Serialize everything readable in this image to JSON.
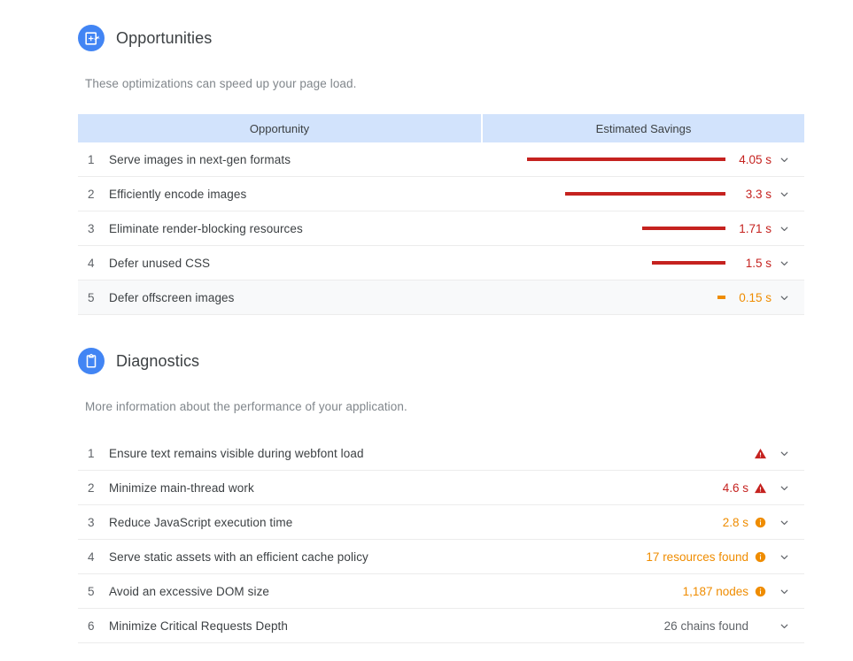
{
  "opportunities": {
    "icon": "opportunity-image-icon",
    "title": "Opportunities",
    "subtitle": "These optimizations can speed up your page load.",
    "columns": {
      "name": "Opportunity",
      "savings": "Estimated Savings"
    },
    "rows": [
      {
        "index": "1",
        "title": "Serve images in next-gen formats",
        "value": "4.05 s",
        "bar_pct": 100,
        "severity": "fail"
      },
      {
        "index": "2",
        "title": "Efficiently encode images",
        "value": "3.3 s",
        "bar_pct": 81,
        "severity": "fail"
      },
      {
        "index": "3",
        "title": "Eliminate render-blocking resources",
        "value": "1.71 s",
        "bar_pct": 42,
        "severity": "fail"
      },
      {
        "index": "4",
        "title": "Defer unused CSS",
        "value": "1.5 s",
        "bar_pct": 37,
        "severity": "fail"
      },
      {
        "index": "5",
        "title": "Defer offscreen images",
        "value": "0.15 s",
        "bar_pct": 4,
        "severity": "average"
      }
    ]
  },
  "diagnostics": {
    "icon": "clipboard-icon",
    "title": "Diagnostics",
    "subtitle": "More information about the performance of your application.",
    "rows": [
      {
        "index": "1",
        "title": "Ensure text remains visible during webfont load",
        "value": "",
        "status": "fail",
        "status_icon": "warning-triangle-icon"
      },
      {
        "index": "2",
        "title": "Minimize main-thread work",
        "value": "4.6 s",
        "status": "fail",
        "status_icon": "warning-triangle-icon"
      },
      {
        "index": "3",
        "title": "Reduce JavaScript execution time",
        "value": "2.8 s",
        "status": "average",
        "status_icon": "info-circle-icon"
      },
      {
        "index": "4",
        "title": "Serve static assets with an efficient cache policy",
        "value": "17 resources found",
        "status": "average",
        "status_icon": "info-circle-icon"
      },
      {
        "index": "5",
        "title": "Avoid an excessive DOM size",
        "value": "1,187 nodes",
        "status": "average",
        "status_icon": "info-circle-icon"
      },
      {
        "index": "6",
        "title": "Minimize Critical Requests Depth",
        "value": "26 chains found",
        "status": "none",
        "status_icon": ""
      }
    ]
  },
  "colors": {
    "accent_blue": "#4285f4",
    "header_blue": "#d2e3fc",
    "fail_red": "#c5221f",
    "average_orange": "#ef8c00",
    "neutral_gray": "#5f6368",
    "alt_row": "#f8f9fa"
  }
}
